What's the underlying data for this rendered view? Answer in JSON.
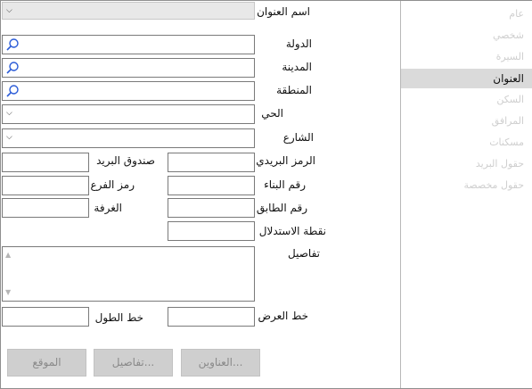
{
  "sidebar": {
    "items": [
      {
        "label": "عام",
        "active": false
      },
      {
        "label": "شخصي",
        "active": false
      },
      {
        "label": "السيرة",
        "active": false
      },
      {
        "label": "العنوان",
        "active": true
      },
      {
        "label": "السكن",
        "active": false
      },
      {
        "label": "المرافق",
        "active": false
      },
      {
        "label": "مسكنات",
        "active": false
      },
      {
        "label": "حقول البريد",
        "active": false
      },
      {
        "label": "حقول مخصصة",
        "active": false
      }
    ]
  },
  "form": {
    "address_name_label": "اسم العنوان",
    "country_label": "الدولة",
    "city_label": "المدينة",
    "region_label": "المنطقة",
    "district_label": "الحي",
    "street_label": "الشارع",
    "postal_code_label": "الرمز البريدي",
    "po_box_label": "صندوق البريد",
    "building_no_label": "رقم البناء",
    "branch_code_label": "رمز الفرع",
    "floor_no_label": "رقم الطابق",
    "room_label": "الغرفة",
    "landmark_label": "نقطة الاستدلال",
    "details_label": "تفاصيل",
    "latitude_label": "خط العرض",
    "longitude_label": "خط الطول",
    "values": {
      "address_name": "",
      "country": "",
      "city": "",
      "region": "",
      "district": "",
      "street": "",
      "postal_code": "",
      "po_box": "",
      "building_no": "",
      "branch_code": "",
      "floor_no": "",
      "room": "",
      "landmark": "",
      "details": "",
      "latitude": "",
      "longitude": ""
    }
  },
  "buttons": {
    "addresses_label": "العناوين...",
    "details_label": "تفاصيل...",
    "location_label": "الموقع"
  },
  "icons": {
    "search": "magnifier-icon",
    "dropdown": "chevron-down-icon"
  },
  "colors": {
    "active_sidebar_bg": "#dadada",
    "disabled_button_bg": "#cfcfcf",
    "disabled_text": "#8a8a8a"
  }
}
